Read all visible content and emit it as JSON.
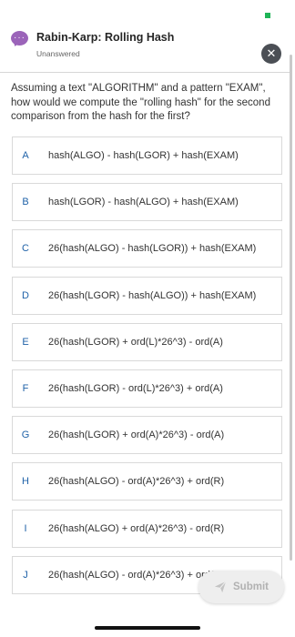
{
  "header": {
    "title": "Rabin-Karp: Rolling Hash",
    "status": "Unanswered",
    "close_glyph": "✕",
    "chat_glyph": "···"
  },
  "question": {
    "text": "Assuming a text \"ALGORITHM\" and a pattern \"EXAM\", how would we compute the \"rolling hash\" for the second comparison from the hash for the first?"
  },
  "options": [
    {
      "letter": "A",
      "text": "hash(ALGO) - hash(LGOR) + hash(EXAM)"
    },
    {
      "letter": "B",
      "text": "hash(LGOR) - hash(ALGO) + hash(EXAM)"
    },
    {
      "letter": "C",
      "text": "26(hash(ALGO) - hash(LGOR)) + hash(EXAM)"
    },
    {
      "letter": "D",
      "text": "26(hash(LGOR) - hash(ALGO)) + hash(EXAM)"
    },
    {
      "letter": "E",
      "text": "26(hash(LGOR) + ord(L)*26^3) - ord(A)"
    },
    {
      "letter": "F",
      "text": "26(hash(LGOR) - ord(L)*26^3) + ord(A)"
    },
    {
      "letter": "G",
      "text": "26(hash(LGOR) + ord(A)*26^3) - ord(A)"
    },
    {
      "letter": "H",
      "text": "26(hash(ALGO) - ord(A)*26^3) + ord(R)"
    },
    {
      "letter": "I",
      "text": "26(hash(ALGO) + ord(A)*26^3) - ord(R)"
    },
    {
      "letter": "J",
      "text": "26(hash(ALGO) - ord(A)*26^3) + ord(R)"
    }
  ],
  "submit": {
    "label": "Submit",
    "icon": "send-icon"
  },
  "colors": {
    "accent": "#1f62a8",
    "chat_icon": "#9b64b9",
    "flag": "#1fb457",
    "close_button": "#4b4f55",
    "submit_disabled_bg": "#eeeeee"
  }
}
